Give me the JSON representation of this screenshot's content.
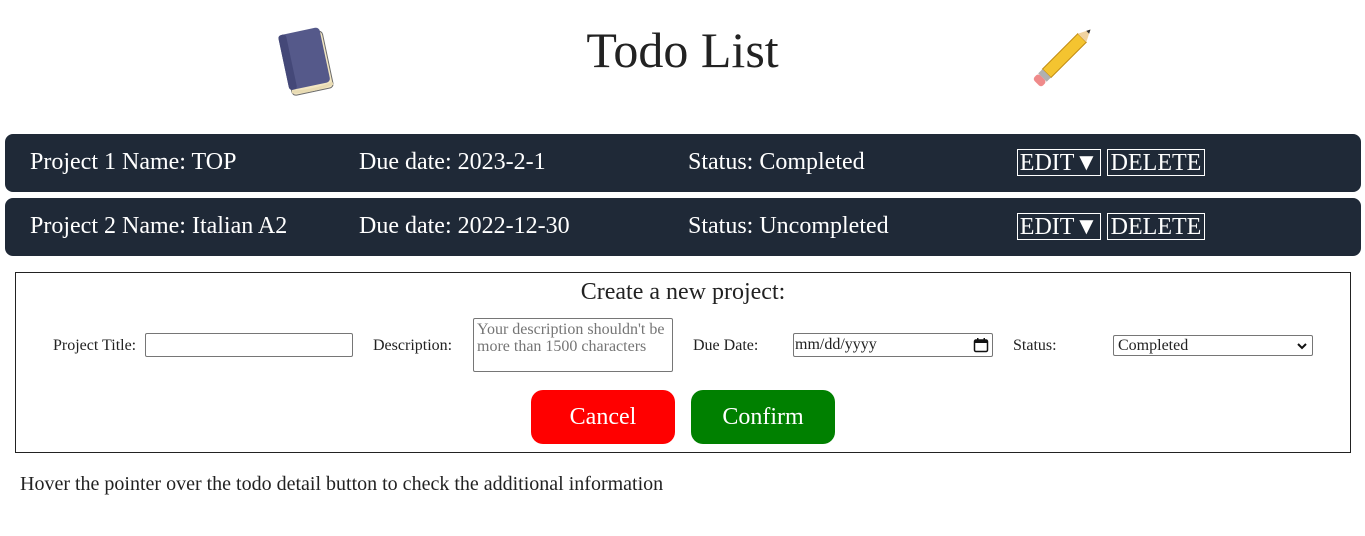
{
  "header": {
    "title": "Todo List",
    "left_icon": "book-icon",
    "right_icon": "pencil-icon"
  },
  "projects": [
    {
      "name": "Project 1 Name: TOP",
      "due": "Due date: 2023-2-1",
      "status": "Status: Completed",
      "edit_label": "EDIT▼",
      "delete_label": "DELETE"
    },
    {
      "name": "Project 2 Name: Italian A2",
      "due": "Due date: 2022-12-30",
      "status": "Status: Uncompleted",
      "edit_label": "EDIT▼",
      "delete_label": "DELETE"
    }
  ],
  "form": {
    "heading": "Create a new project:",
    "title_label": "Project Title:",
    "title_value": "",
    "description_label": "Description:",
    "description_placeholder": "Your description shouldn't be more than 1500 characters",
    "due_label": "Due Date:",
    "due_placeholder": "mm/dd/yyyy",
    "status_label": "Status:",
    "status_selected": "Completed",
    "cancel_label": "Cancel",
    "confirm_label": "Confirm"
  },
  "hint": "Hover the pointer over the todo detail button to check the additional information",
  "colors": {
    "row_bg": "#1f2937",
    "cancel_bg": "#ff0000",
    "confirm_bg": "#008000"
  }
}
